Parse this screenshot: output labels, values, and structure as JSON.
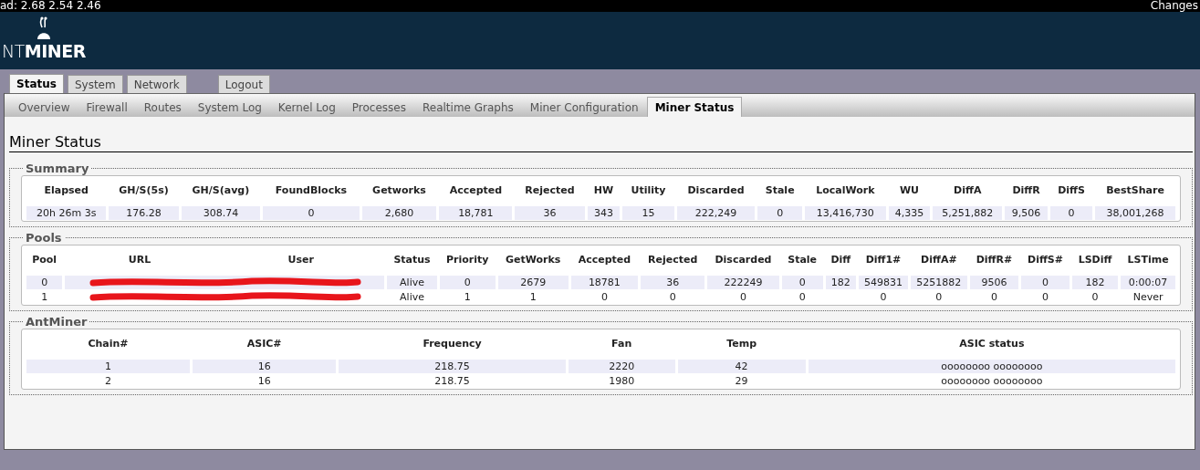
{
  "top_bar": {
    "load": "ad: 2.68 2.54 2.46",
    "changes": "Changes"
  },
  "logo": "NT**MINER**",
  "tabs": [
    {
      "label": "Status",
      "selected": true
    },
    {
      "label": "System",
      "selected": false
    },
    {
      "label": "Network",
      "selected": false
    },
    {
      "label": "Logout",
      "selected": false,
      "kind": "separate"
    }
  ],
  "subtabs": [
    {
      "label": "Overview",
      "selected": false
    },
    {
      "label": "Firewall",
      "selected": false
    },
    {
      "label": "Routes",
      "selected": false
    },
    {
      "label": "System Log",
      "selected": false
    },
    {
      "label": "Kernel Log",
      "selected": false
    },
    {
      "label": "Processes",
      "selected": false
    },
    {
      "label": "Realtime Graphs",
      "selected": false
    },
    {
      "label": "Miner Configuration",
      "selected": false
    },
    {
      "label": "Miner Status",
      "selected": true
    }
  ],
  "page_title": "Miner Status",
  "sections": [
    {
      "legend": "Summary",
      "columns": [
        "Elapsed",
        "GH/S(5s)",
        "GH/S(avg)",
        "FoundBlocks",
        "Getworks",
        "Accepted",
        "Rejected",
        "HW",
        "Utility",
        "Discarded",
        "Stale",
        "LocalWork",
        "WU",
        "DiffA",
        "DiffR",
        "DiffS",
        "BestShare"
      ],
      "rows": [
        {
          "cells": [
            "20h 26m 3s",
            "176.28",
            "308.74",
            "0",
            "2,680",
            "18,781",
            "36",
            "343",
            "15",
            "222,249",
            "0",
            "13,416,730",
            "4,335",
            "5,251,882",
            "9,506",
            "0",
            "38,001,268"
          ]
        }
      ]
    },
    {
      "legend": "Pools",
      "columns": [
        "Pool",
        "URL",
        "User",
        "Status",
        "Priority",
        "GetWorks",
        "Accepted",
        "Rejected",
        "Discarded",
        "Stale",
        "Diff",
        "Diff1#",
        "DiffA#",
        "DiffR#",
        "DiffS#",
        "LSDiff",
        "LSTime"
      ],
      "rows": [
        {
          "redacted": true,
          "cells": [
            "0",
            "",
            "",
            "Alive",
            "0",
            "2679",
            "18781",
            "36",
            "222249",
            "0",
            "182",
            "549831",
            "5251882",
            "9506",
            "0",
            "182",
            "0:00:07"
          ]
        },
        {
          "redacted": true,
          "cells": [
            "1",
            "",
            "",
            "Alive",
            "1",
            "1",
            "0",
            "0",
            "0",
            "0",
            "",
            "0",
            "0",
            "0",
            "0",
            "0",
            "Never"
          ]
        }
      ]
    },
    {
      "legend": "AntMiner",
      "columns": [
        "Chain#",
        "ASIC#",
        "Frequency",
        "Fan",
        "Temp",
        "ASIC status"
      ],
      "rows": [
        {
          "cells": [
            "1",
            "16",
            "218.75",
            "2220",
            "42",
            "oooooooo oooooooo"
          ]
        },
        {
          "cells": [
            "2",
            "16",
            "218.75",
            "1980",
            "29",
            "oooooooo oooooooo"
          ]
        }
      ]
    }
  ]
}
